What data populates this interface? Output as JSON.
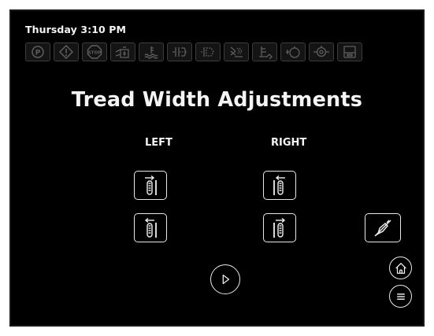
{
  "status": {
    "datetime": "Thursday 3:10 PM"
  },
  "indicators": [
    {
      "icon": "parking-brake-icon"
    },
    {
      "icon": "warning-icon"
    },
    {
      "icon": "stop-icon",
      "text": "STOP"
    },
    {
      "icon": "hydraulic-oil-icon"
    },
    {
      "icon": "coolant-level-icon"
    },
    {
      "icon": "transmission-filter-icon"
    },
    {
      "icon": "hydraulic-filter-icon"
    },
    {
      "icon": "air-filter-icon"
    },
    {
      "icon": "fuel-level-icon"
    },
    {
      "icon": "engine-oil-icon"
    },
    {
      "icon": "engine-icon"
    },
    {
      "icon": "fuel-tank-icon"
    }
  ],
  "page": {
    "title": "Tread Width Adjustments",
    "left_label": "LEFT",
    "right_label": "RIGHT"
  },
  "colors": {
    "background": "#000000",
    "foreground": "#f0f0f0",
    "indicator_dim": "#5a5a5a"
  }
}
